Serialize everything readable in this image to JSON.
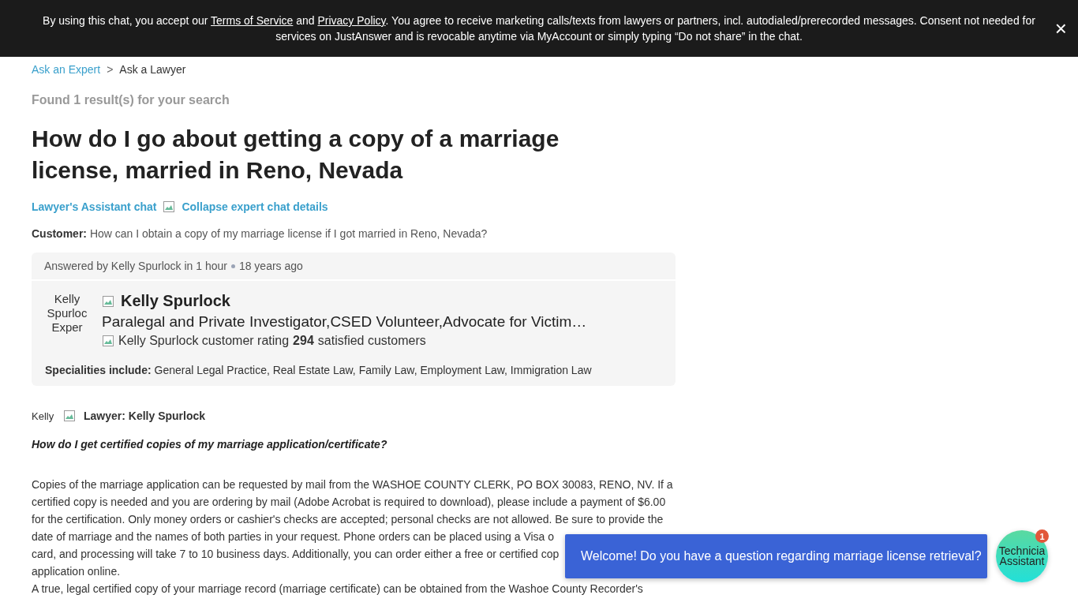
{
  "consent_banner": {
    "parts": [
      {
        "kind": "text",
        "text": "By using this chat, you accept our "
      },
      {
        "kind": "link",
        "text": "Terms of Service"
      },
      {
        "kind": "text",
        "text": " and "
      },
      {
        "kind": "link",
        "text": "Privacy Policy"
      },
      {
        "kind": "text",
        "text": ". You agree to receive marketing calls/texts from lawyers or partners, incl. autodialed/prerecorded messages. Consent not needed for services on JustAnswer and is revocable anytime via MyAccount or simply typing “Do not share” in the chat."
      }
    ],
    "close": "×"
  },
  "breadcrumb": {
    "items": [
      {
        "label": "Ask an Expert",
        "kind": "link"
      },
      {
        "label": "Ask a Lawyer",
        "kind": "current"
      }
    ],
    "separator": ">"
  },
  "result_count": "Found 1 result(s) for your search",
  "question_title": "How do I go about getting a copy of a marriage license, married in Reno, Nevada",
  "chat_link": "Lawyer's Assistant chat",
  "collapse_link": "Collapse expert chat details",
  "customer": {
    "label": "Customer:",
    "text": "How can I obtain a copy of my marriage license if I got married in Reno, Nevada?"
  },
  "expert_card": {
    "answered": "Answered by Kelly Spurlock in 1 hour",
    "age": "18 years ago",
    "avatar_alt": "Kelly Spurloc Exper",
    "name": "Kelly Spurlock",
    "title": "Paralegal and Private Investigator,CSED Volunteer,Advocate for Victim…",
    "rating_alt": "Kelly Spurlock customer rating",
    "satisfied_count": "294",
    "satisfied_label": "satisfied customers",
    "specialities_label": "Specialities include:",
    "specialities": "General Legal Practice, Real Estate Law, Family Law, Employment Law, Immigration Law"
  },
  "answer": {
    "avatar_alt": "Kelly",
    "author": "Lawyer: Kelly Spurlock",
    "question": "How do I get certified copies of my marriage application/certificate?",
    "lines": [
      "Copies of the marriage application can be requested by mail from the WASHOE COUNTY CLERK, PO BOX 30083, RENO, NV. If a",
      "certified copy is needed and you are ordering by mail (Adobe Acrobat is required to download), please include a payment of $6.00",
      "for the certification. Only money orders or cashier's checks are accepted; personal checks are not allowed. Be sure to provide the",
      "date of marriage and the names of both parties in your request. Phone orders can be placed using a Visa o",
      "card, and processing will take 7 to 10 business days. Additionally, you can order either a free or certified cop",
      "application online.",
      "A true, legal certified copy of your marriage record (marriage certificate) can be obtained from the Washoe County Recorder's"
    ]
  },
  "chat_widget": {
    "message": "Welcome! Do you have a question regarding marriage license retrieval?",
    "avatar_alt": "Technicia Assistant",
    "badge": "1"
  }
}
